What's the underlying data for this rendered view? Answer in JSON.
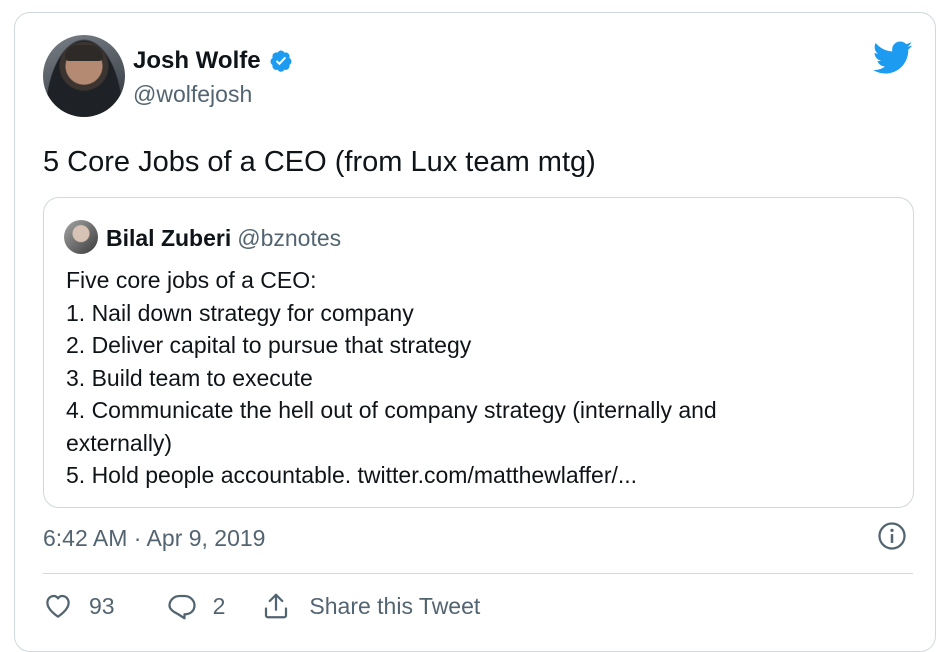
{
  "author": {
    "name": "Josh Wolfe",
    "handle": "@wolfejosh",
    "verified": true
  },
  "tweet": {
    "text": "5 Core Jobs of a CEO (from Lux team mtg)"
  },
  "quoted_tweet": {
    "name": "Bilal Zuberi",
    "handle": "@bznotes",
    "lines": [
      "Five core jobs of a CEO:",
      "1. Nail down strategy for company",
      "2. Deliver capital to pursue that strategy",
      "3. Build team to execute",
      "4. Communicate the hell out of company strategy (internally and",
      "externally)",
      "5. Hold people accountable. twitter.com/matthewlaffer/..."
    ]
  },
  "timestamp": "6:42 AM · Apr 9, 2019",
  "actions": {
    "likes": "93",
    "replies": "2",
    "share_label": "Share this Tweet"
  },
  "icons": {
    "verified": "verified-badge-icon",
    "brand": "twitter-bird-icon",
    "info": "info-icon",
    "like": "heart-icon",
    "reply": "reply-icon",
    "share": "share-icon"
  },
  "colors": {
    "twitter_blue": "#1d9bf0",
    "text_primary": "#0f1419",
    "text_secondary": "#536471",
    "border": "#cfd9de"
  }
}
